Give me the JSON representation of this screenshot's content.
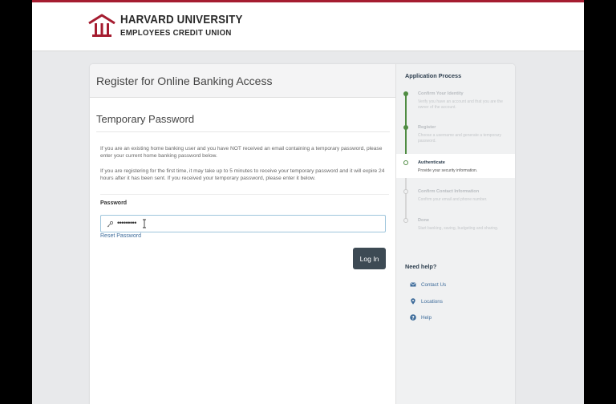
{
  "brand": {
    "name_line1": "HARVARD UNIVERSITY",
    "name_line2": "EMPLOYEES CREDIT UNION",
    "colors": {
      "crimson": "#a51c30",
      "green": "#4f8c42",
      "button": "#3d4a54",
      "link": "#3d6b9a"
    }
  },
  "main": {
    "title": "Register for Online Banking Access",
    "section_title": "Temporary Password",
    "paragraph1": "If you are an existing home banking user and you have NOT received an email containing a temporary password, please enter your current home banking password below.",
    "paragraph2": "If you are registering for the first time, it may take up to 5 minutes to receive your temporary password and it will expire 24 hours after it has been sent. If you received your temporary password, please enter it below.",
    "password_label": "Password",
    "password_value": "•••••••••",
    "reset_link": "Reset Password",
    "login_button": "Log In",
    "icons": {
      "password_field": "key-icon",
      "cursor": "text-cursor-icon"
    }
  },
  "sidebar": {
    "title": "Application Process",
    "steps": [
      {
        "title": "Confirm Your Identity",
        "desc": "Verify you have an account and that you are the owner of the account.",
        "state": "done"
      },
      {
        "title": "Register",
        "desc": "Choose a username and generate a temporary password.",
        "state": "done"
      },
      {
        "title": "Authenticate",
        "desc": "Provide your security information.",
        "state": "current"
      },
      {
        "title": "Confirm Contact Information",
        "desc": "Confirm your email and phone number.",
        "state": "todo"
      },
      {
        "title": "Done",
        "desc": "Start banking, saving, budgeting and sharing.",
        "state": "todo"
      }
    ],
    "help_title": "Need help?",
    "help_items": [
      {
        "label": "Contact Us",
        "icon": "envelope-icon"
      },
      {
        "label": "Locations",
        "icon": "map-pin-icon"
      },
      {
        "label": "Help",
        "icon": "question-circle-icon"
      }
    ]
  }
}
